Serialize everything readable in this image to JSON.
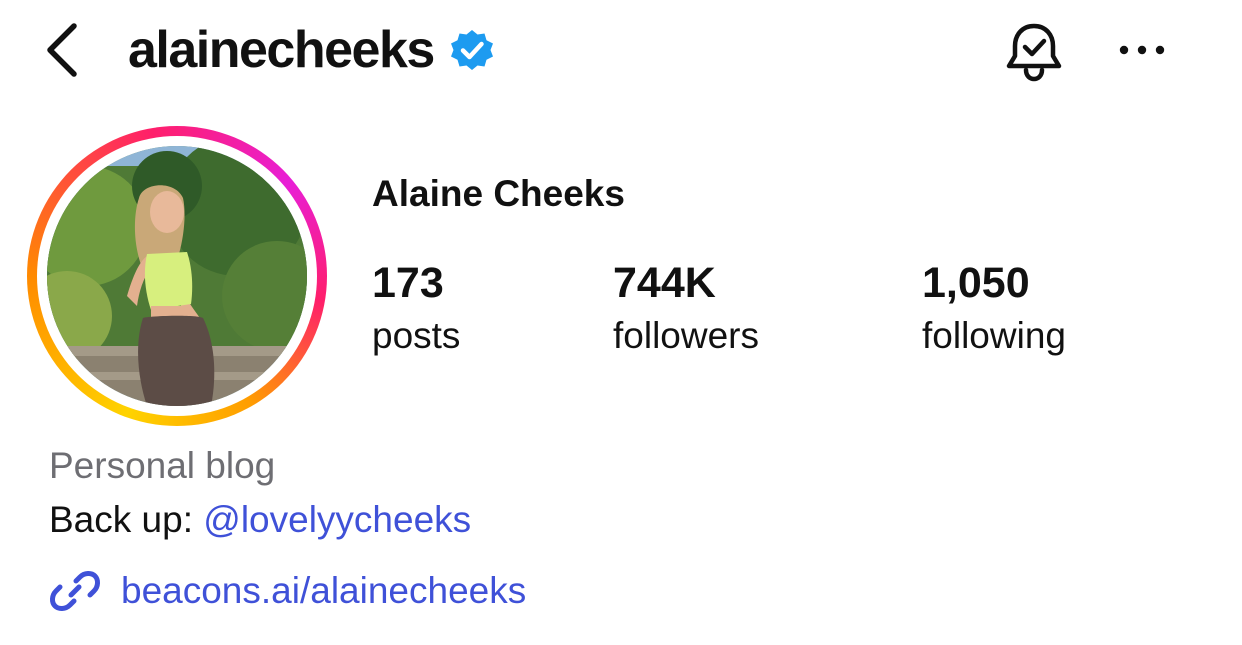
{
  "header": {
    "username": "alainecheeks",
    "back_icon": "chevron-left-icon",
    "verified_icon": "verified-badge-icon",
    "notifications_icon": "bell-check-icon",
    "more_icon": "more-horizontal-icon"
  },
  "profile": {
    "display_name": "Alaine Cheeks",
    "stats": [
      {
        "value": "173",
        "label": "posts"
      },
      {
        "value": "744K",
        "label": "followers"
      },
      {
        "value": "1,050",
        "label": "following"
      }
    ]
  },
  "bio": {
    "category": "Personal blog",
    "backup_prefix": "Back up: ",
    "backup_handle": "@lovelyycheeks",
    "link_icon": "link-icon",
    "link_text": "beacons.ai/alainecheeks"
  },
  "colors": {
    "link_blue": "#3f51d8",
    "verified_blue": "#1d9bf0",
    "category_gray": "#6e6e73",
    "text": "#111111"
  }
}
